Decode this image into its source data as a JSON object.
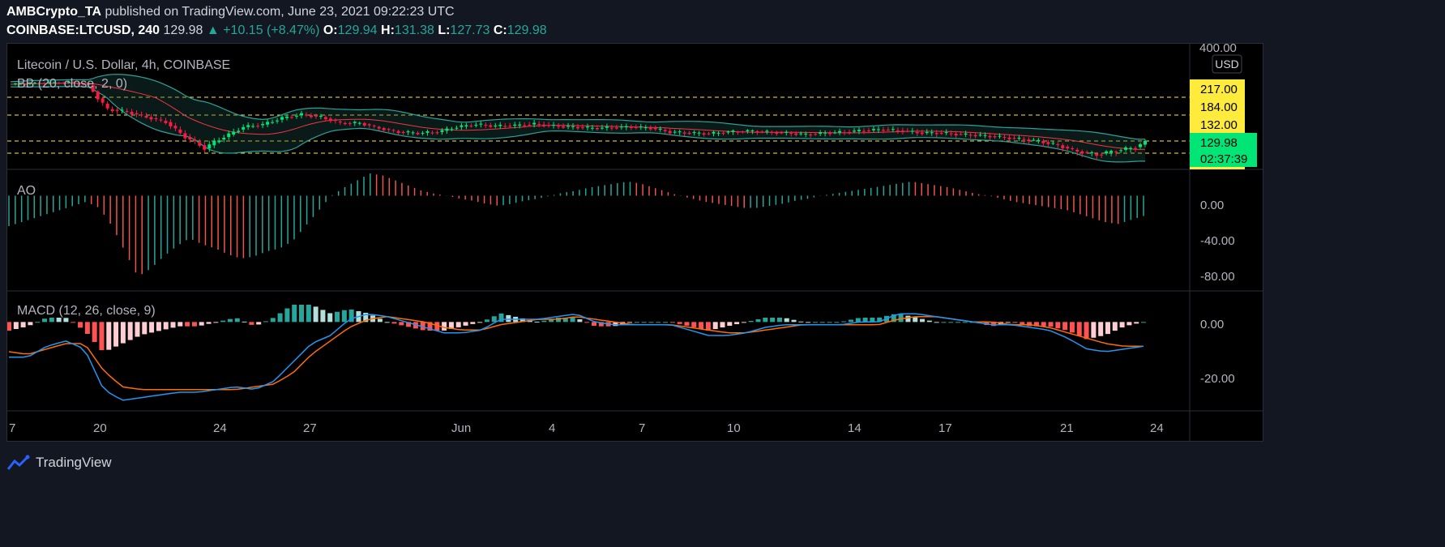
{
  "header": {
    "author": "AMBCrypto_TA",
    "published": "published on TradingView.com, June 23, 2021 09:22:23 UTC",
    "symbol": "COINBASE:LTCUSD, 240",
    "last": "129.98",
    "change": "+10.15 (+8.47%)",
    "o_label": "O:",
    "o": "129.94",
    "h_label": "H:",
    "h": "131.38",
    "l_label": "L:",
    "l": "127.73",
    "c_label": "C:",
    "c": "129.98"
  },
  "chart": {
    "title": "Litecoin / U.S. Dollar, 4h, COINBASE",
    "currency": "USD",
    "bb_label": "BB (20, close, 2, 0)",
    "ao_label": "AO",
    "macd_label": "MACD (12, 26, close, 9)",
    "price_top_label": "400.00",
    "level_labels": [
      "217.00",
      "184.00",
      "132.00"
    ],
    "current_price": "129.98",
    "countdown": "02:37:39",
    "ao_ticks": [
      "0.00",
      "-40.00",
      "-80.00"
    ],
    "macd_ticks": [
      "0.00",
      "-20.00"
    ],
    "x_ticks": [
      "7",
      "20",
      "24",
      "27",
      "Jun",
      "4",
      "7",
      "10",
      "14",
      "17",
      "21",
      "24"
    ]
  },
  "chart_data": [
    {
      "type": "candlestick",
      "title": "Litecoin / U.S. Dollar, 4h, COINBASE",
      "ylabel": "USD",
      "horizontal_levels": [
        217.0,
        184.0,
        132.0,
        112.0
      ],
      "last_price": 129.98,
      "ylim": [
        95,
        400
      ],
      "close_approx": [
        [
          0,
          265
        ],
        [
          6,
          270
        ],
        [
          12,
          272
        ],
        [
          16,
          262
        ],
        [
          18,
          215
        ],
        [
          20,
          195
        ],
        [
          24,
          190
        ],
        [
          28,
          180
        ],
        [
          32,
          170
        ],
        [
          36,
          140
        ],
        [
          40,
          120
        ],
        [
          44,
          140
        ],
        [
          48,
          160
        ],
        [
          52,
          165
        ],
        [
          56,
          178
        ],
        [
          60,
          185
        ],
        [
          64,
          180
        ],
        [
          68,
          168
        ],
        [
          72,
          168
        ],
        [
          76,
          158
        ],
        [
          80,
          150
        ],
        [
          84,
          148
        ],
        [
          88,
          150
        ],
        [
          92,
          160
        ],
        [
          96,
          165
        ],
        [
          100,
          162
        ],
        [
          104,
          163
        ],
        [
          108,
          166
        ],
        [
          112,
          162
        ],
        [
          116,
          160
        ],
        [
          120,
          158
        ],
        [
          124,
          159
        ],
        [
          128,
          160
        ],
        [
          132,
          158
        ],
        [
          136,
          150
        ],
        [
          140,
          148
        ],
        [
          144,
          147
        ],
        [
          148,
          150
        ],
        [
          152,
          152
        ],
        [
          156,
          150
        ],
        [
          160,
          148
        ],
        [
          164,
          145
        ],
        [
          168,
          148
        ],
        [
          172,
          150
        ],
        [
          176,
          153
        ],
        [
          180,
          155
        ],
        [
          184,
          152
        ],
        [
          188,
          148
        ],
        [
          192,
          148
        ],
        [
          196,
          145
        ],
        [
          200,
          143
        ],
        [
          204,
          140
        ],
        [
          208,
          136
        ],
        [
          212,
          132
        ],
        [
          216,
          125
        ],
        [
          220,
          115
        ],
        [
          224,
          110
        ],
        [
          228,
          116
        ],
        [
          232,
          122
        ],
        [
          234,
          129.98
        ]
      ],
      "bollinger": {
        "period": 20,
        "source": "close",
        "stddev": 2,
        "offset": 0
      }
    },
    {
      "type": "bar",
      "title": "AO",
      "ylim": [
        -90,
        22
      ],
      "values_approx": [
        -30,
        -26,
        -22,
        -18,
        -14,
        -10,
        -6,
        -12,
        -30,
        -55,
        -80,
        -72,
        -60,
        -50,
        -42,
        -48,
        -52,
        -58,
        -62,
        -60,
        -55,
        -52,
        -45,
        -30,
        -15,
        0,
        8,
        15,
        22,
        20,
        15,
        10,
        5,
        2,
        0,
        -3,
        -5,
        -8,
        -10,
        -8,
        -5,
        -3,
        0,
        3,
        5,
        8,
        10,
        12,
        14,
        12,
        8,
        4,
        0,
        -3,
        -6,
        -8,
        -10,
        -12,
        -12,
        -10,
        -8,
        -5,
        -3,
        0,
        2,
        4,
        6,
        8,
        10,
        12,
        14,
        12,
        10,
        8,
        5,
        2,
        0,
        -3,
        -6,
        -8,
        -10,
        -12,
        -14,
        -18,
        -22,
        -26,
        -28,
        -24,
        -20
      ]
    },
    {
      "type": "line",
      "title": "MACD (12, 26, close, 9)",
      "ylim": [
        -32,
        10
      ],
      "series": [
        {
          "name": "MACD",
          "values_approx": [
            -13,
            -13,
            -9,
            -7,
            -10,
            -25,
            -29,
            -28,
            -27,
            -26,
            -26,
            -25,
            -24,
            -25,
            -22,
            -15,
            -8,
            -5,
            1,
            3,
            2,
            0,
            -2,
            -4,
            -4,
            -3,
            1,
            1,
            1,
            2,
            3,
            0,
            -1,
            -1,
            -1,
            -1,
            -3,
            -5,
            -5,
            -4,
            -2,
            -1,
            -1,
            -1,
            -1,
            0,
            0,
            3,
            3,
            2,
            1,
            0,
            -1,
            -1,
            -2,
            -3,
            -6,
            -10,
            -11,
            -10,
            -9
          ]
        },
        {
          "name": "Signal",
          "values_approx": [
            -11,
            -12,
            -10,
            -8,
            -8,
            -18,
            -24,
            -25,
            -25,
            -25,
            -25,
            -25,
            -25,
            -24,
            -23,
            -19,
            -12,
            -7,
            -2,
            1,
            2,
            1,
            0,
            -2,
            -3,
            -3,
            -1,
            0,
            1,
            1,
            2,
            1,
            0,
            -1,
            -1,
            -1,
            -2,
            -3,
            -4,
            -4,
            -3,
            -2,
            -1,
            -1,
            -1,
            -1,
            -1,
            1,
            2,
            2,
            1,
            0,
            0,
            -1,
            -1,
            -2,
            -4,
            -6,
            -8,
            -9,
            -9
          ]
        }
      ],
      "histogram": true
    }
  ],
  "footer": {
    "brand": "TradingView"
  },
  "colors": {
    "up": "#26a69a",
    "down": "#ef5350",
    "candle_up": "#00e676",
    "candle_down": "#ff1744",
    "bb_band": "#2aa39a",
    "bb_basis": "#f23645",
    "level": "#ffeb3b",
    "last_price_bg": "#00e676",
    "macd": "#2196f3",
    "signal": "#ff6d00"
  }
}
